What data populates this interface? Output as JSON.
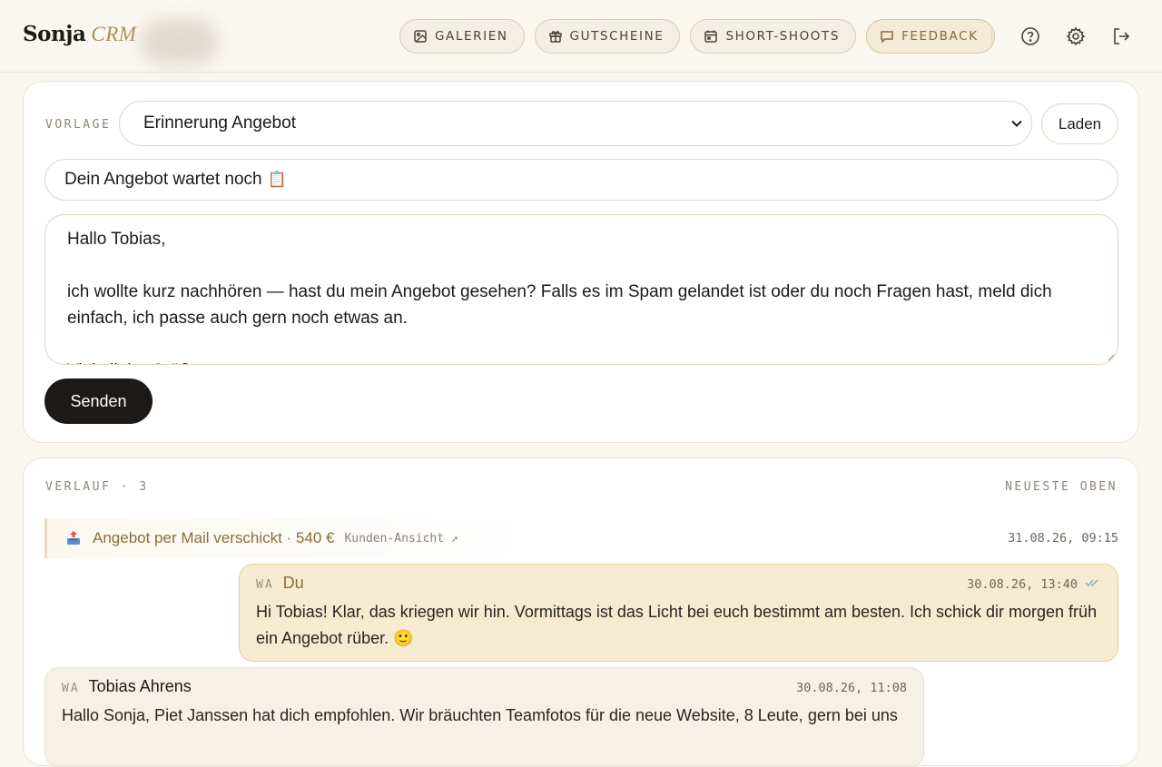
{
  "brand": {
    "name": "Sonja",
    "suffix": "CRM"
  },
  "nav": {
    "items": [
      {
        "label": "GALERIEN",
        "icon": "image-icon"
      },
      {
        "label": "GUTSCHEINE",
        "icon": "gift-icon"
      },
      {
        "label": "SHORT-SHOOTS",
        "icon": "calendar-icon"
      },
      {
        "label": "FEEDBACK",
        "icon": "message-icon"
      }
    ],
    "icons": [
      "help-icon",
      "settings-icon",
      "logout-icon"
    ]
  },
  "composer": {
    "template_label": "VORLAGE",
    "template_value": "Erinnerung Angebot",
    "load_label": "Laden",
    "subject_value": "Dein Angebot wartet noch",
    "subject_emoji": "📋",
    "body_lines": [
      "Hallo Tobias,",
      "",
      "ich wollte kurz nachhören — hast du mein Angebot gesehen? Falls es im Spam gelandet ist oder du noch Fragen hast, meld dich einfach, ich passe auch gern noch etwas an.",
      "",
      "Viele liebe Grüße"
    ],
    "send_label": "Senden"
  },
  "history": {
    "label": "VERLAUF · 3",
    "sort_label": "NEUESTE OBEN",
    "event": {
      "title": "Angebot per Mail verschickt · 540 €",
      "link_label": "Kunden-Ansicht ↗",
      "time": "31.08.26, 09:15",
      "icon": "outbox-icon"
    },
    "messages": [
      {
        "source": "WA",
        "author": "Du",
        "time": "30.08.26, 13:40",
        "read_mark": "✓✓",
        "text": "Hi Tobias! Klar, das kriegen wir hin. Vormittags ist das Licht bei euch bestimmt am besten. Ich schick dir morgen früh ein Angebot rüber. 🙂"
      },
      {
        "source": "WA",
        "author": "Tobias Ahrens",
        "time": "30.08.26, 11:08",
        "text": "Hallo Sonja, Piet Janssen hat dich empfohlen. Wir bräuchten Teamfotos für die neue Website, 8 Leute, gern bei uns"
      }
    ]
  },
  "colors": {
    "background": "#faf7f1",
    "accent_gold": "#8b6e37",
    "primary_button": "#1d1916",
    "outgoing_bubble": "#f6ead1",
    "incoming_bubble": "#f6f1e8",
    "read_check": "#7fb3d9"
  }
}
